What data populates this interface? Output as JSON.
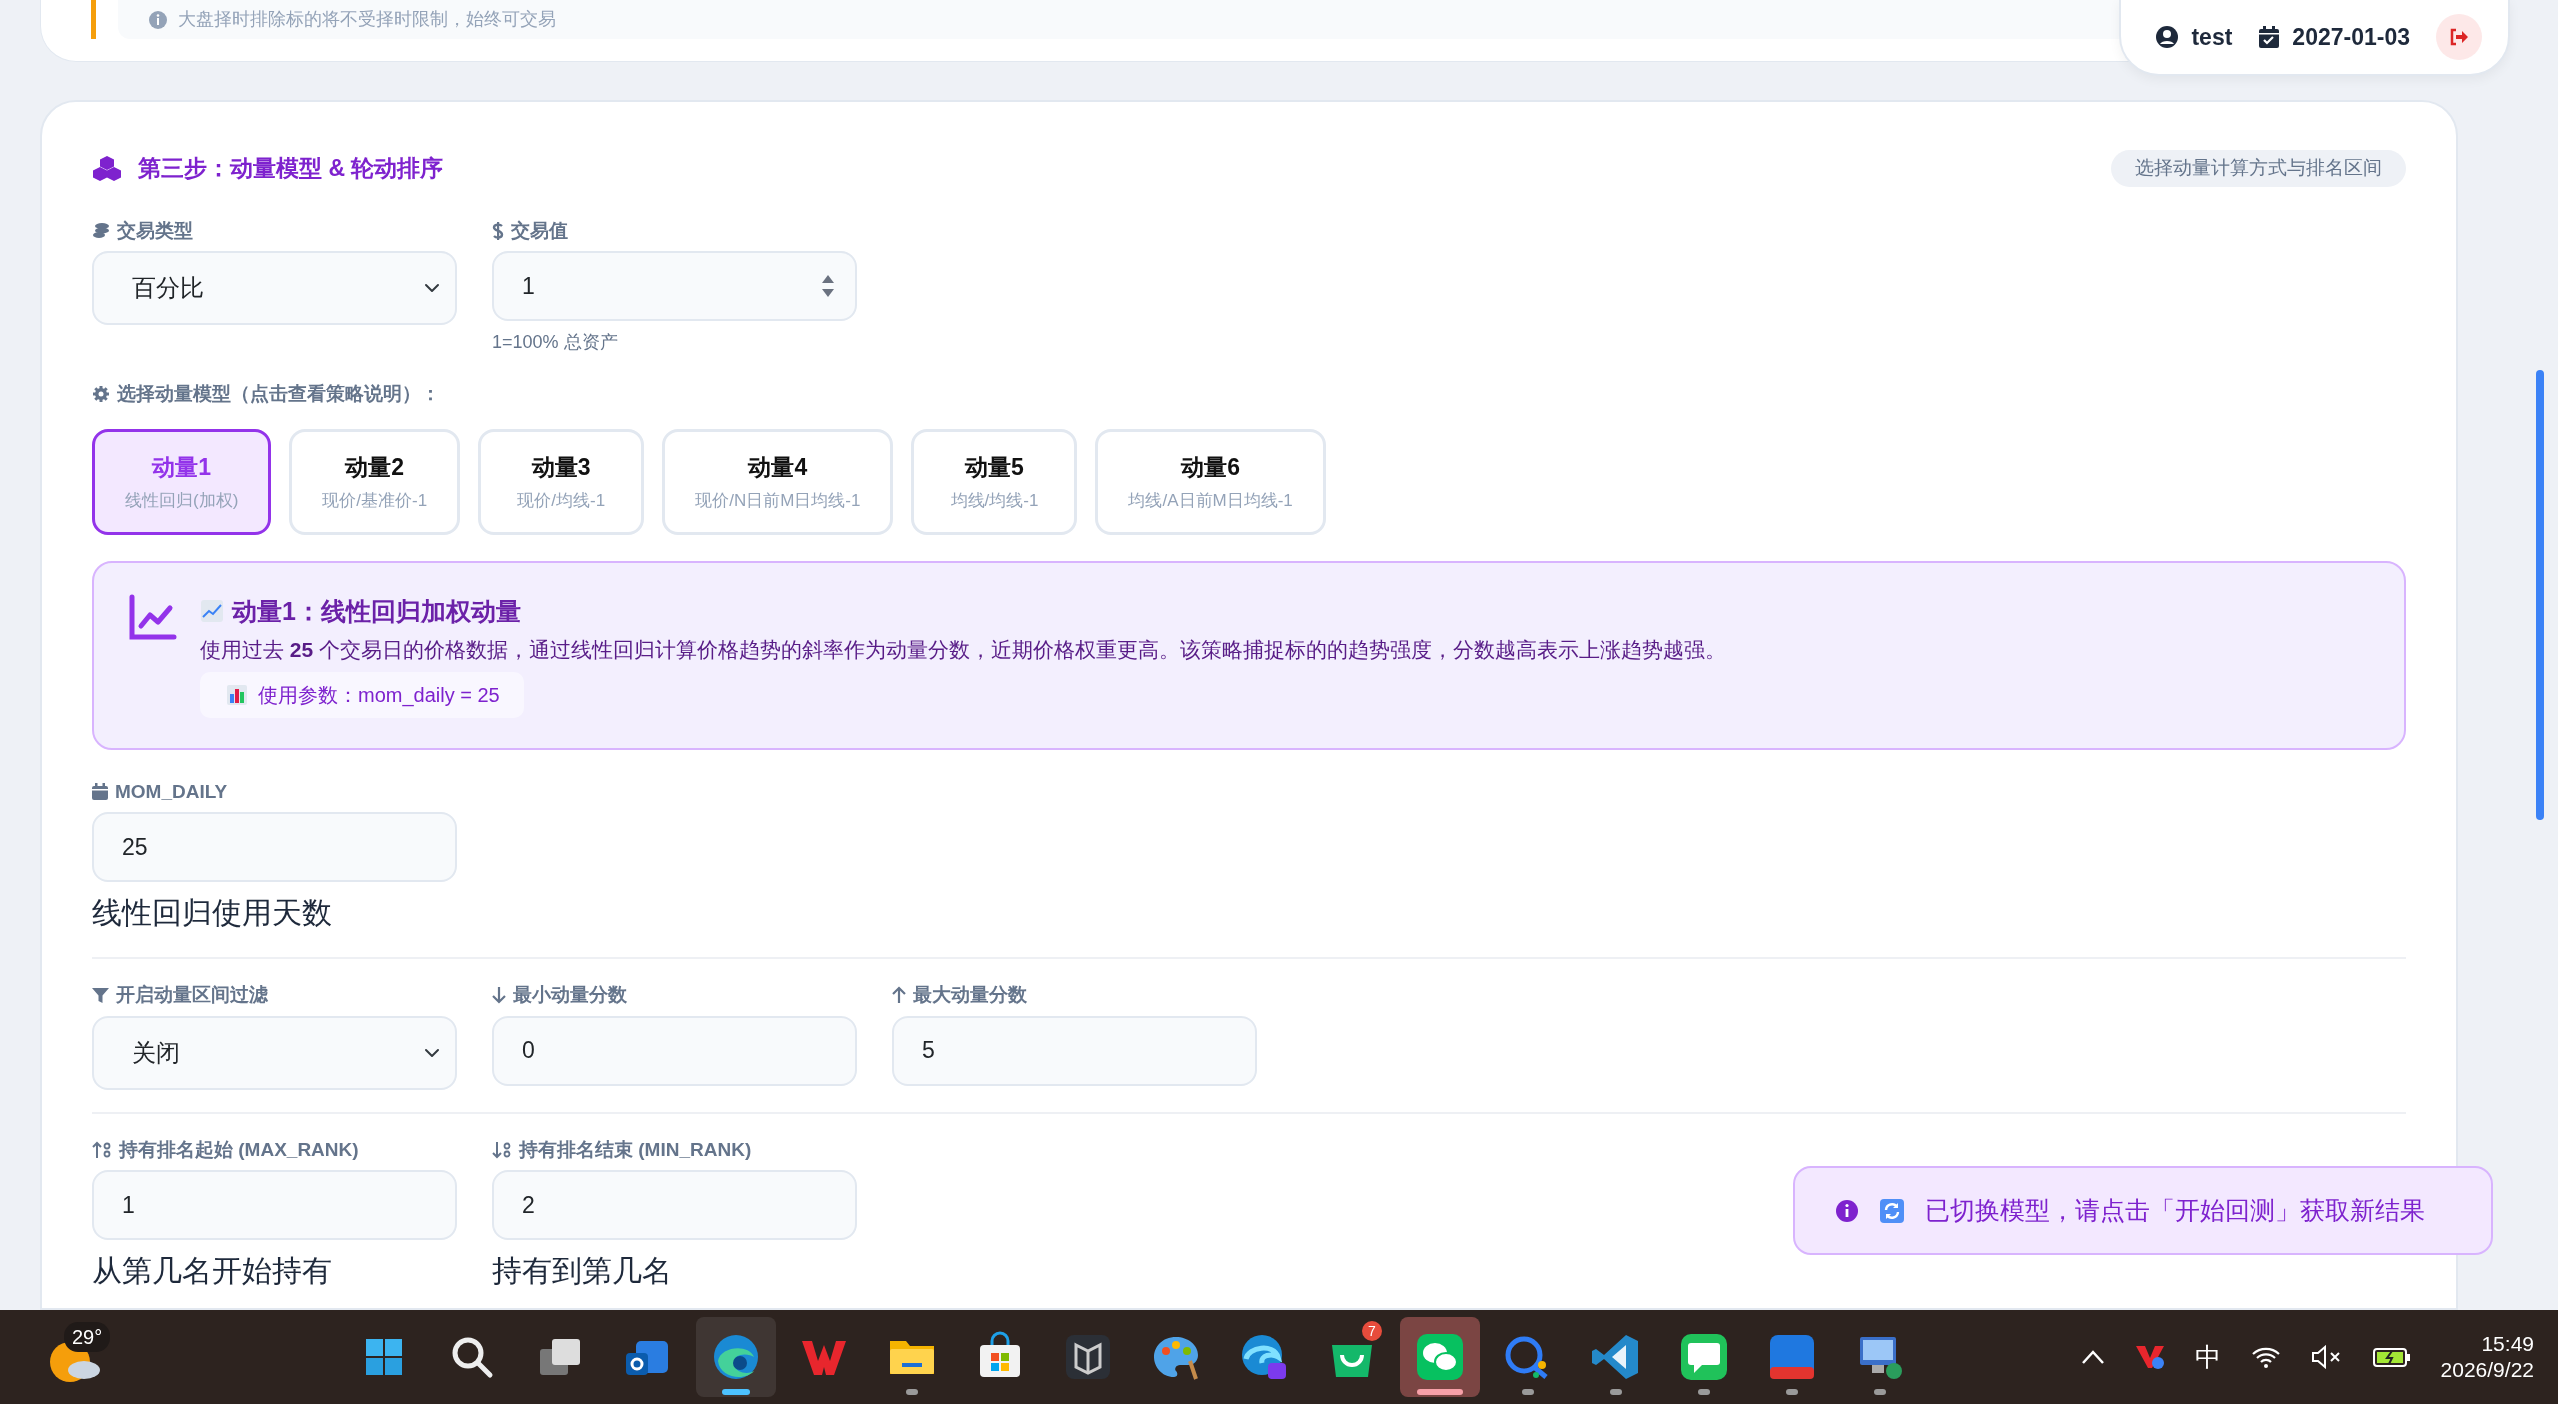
{
  "notice": {
    "text": "大盘择时排除标的将不受择时限制，始终可交易"
  },
  "user": {
    "name": "test",
    "date": "2027-01-03"
  },
  "section": {
    "title": "第三步：动量模型 & 轮动排序",
    "badge": "选择动量计算方式与排名区间"
  },
  "trade_type": {
    "label": "交易类型",
    "value": "百分比"
  },
  "trade_value": {
    "label": "交易值",
    "value": "1",
    "help": "1=100% 总资产"
  },
  "model_label": "选择动量模型（点击查看策略说明）：",
  "models": [
    {
      "name": "动量1",
      "formula": "线性回归(加权)",
      "selected": true
    },
    {
      "name": "动量2",
      "formula": "现价/基准价-1",
      "selected": false
    },
    {
      "name": "动量3",
      "formula": "现价/均线-1",
      "selected": false
    },
    {
      "name": "动量4",
      "formula": "现价/N日前M日均线-1",
      "selected": false
    },
    {
      "name": "动量5",
      "formula": "均线/均线-1",
      "selected": false
    },
    {
      "name": "动量6",
      "formula": "均线/A日前M日均线-1",
      "selected": false
    }
  ],
  "model_info": {
    "title": "动量1：线性回归加权动量",
    "description": "使用过去 **25** 个交易日的价格数据，通过线性回归计算价格趋势的斜率作为动量分数，近期价格权重更高。该策略捕捉标的的趋势强度，分数越高表示上涨趋势越强。",
    "param": "使用参数：mom_daily = 25"
  },
  "mom_daily": {
    "label": "MOM_DAILY",
    "value": "25",
    "help": "线性回归使用天数"
  },
  "filter": {
    "label": "开启动量区间过滤",
    "value": "关闭"
  },
  "min_score": {
    "label": "最小动量分数",
    "value": "0"
  },
  "max_score": {
    "label": "最大动量分数",
    "value": "5"
  },
  "rank_start": {
    "label": "持有排名起始 (MAX_RANK)",
    "value": "1",
    "help": "从第几名开始持有"
  },
  "rank_end": {
    "label": "持有排名结束 (MIN_RANK)",
    "value": "2",
    "help": "持有到第几名"
  },
  "toast": {
    "text": "已切换模型，请点击「开始回测」获取新结果"
  },
  "taskbar": {
    "weather": "29°",
    "apps": [
      {
        "running": false,
        "selected": false,
        "attention": false
      },
      {
        "running": false,
        "selected": false,
        "attention": false
      },
      {
        "running": false,
        "selected": false,
        "attention": false
      },
      {
        "running": false,
        "selected": false,
        "attention": false
      },
      {
        "running": true,
        "selected": true,
        "attention": false
      },
      {
        "running": false,
        "selected": false,
        "attention": false
      },
      {
        "running": true,
        "selected": false,
        "attention": false
      },
      {
        "running": false,
        "selected": false,
        "attention": false
      },
      {
        "running": false,
        "selected": false,
        "attention": false
      },
      {
        "running": false,
        "selected": false,
        "attention": false
      },
      {
        "running": false,
        "selected": false,
        "attention": false
      },
      {
        "running": false,
        "selected": false,
        "attention": false,
        "badge": "7"
      },
      {
        "running": true,
        "selected": false,
        "attention": true
      },
      {
        "running": true,
        "selected": false,
        "attention": false
      },
      {
        "running": true,
        "selected": false,
        "attention": false
      },
      {
        "running": true,
        "selected": false,
        "attention": false
      },
      {
        "running": true,
        "selected": false,
        "attention": false
      },
      {
        "running": true,
        "selected": false,
        "attention": false
      }
    ],
    "ime": "中",
    "time": "15:49",
    "date": "2026/9/22"
  }
}
